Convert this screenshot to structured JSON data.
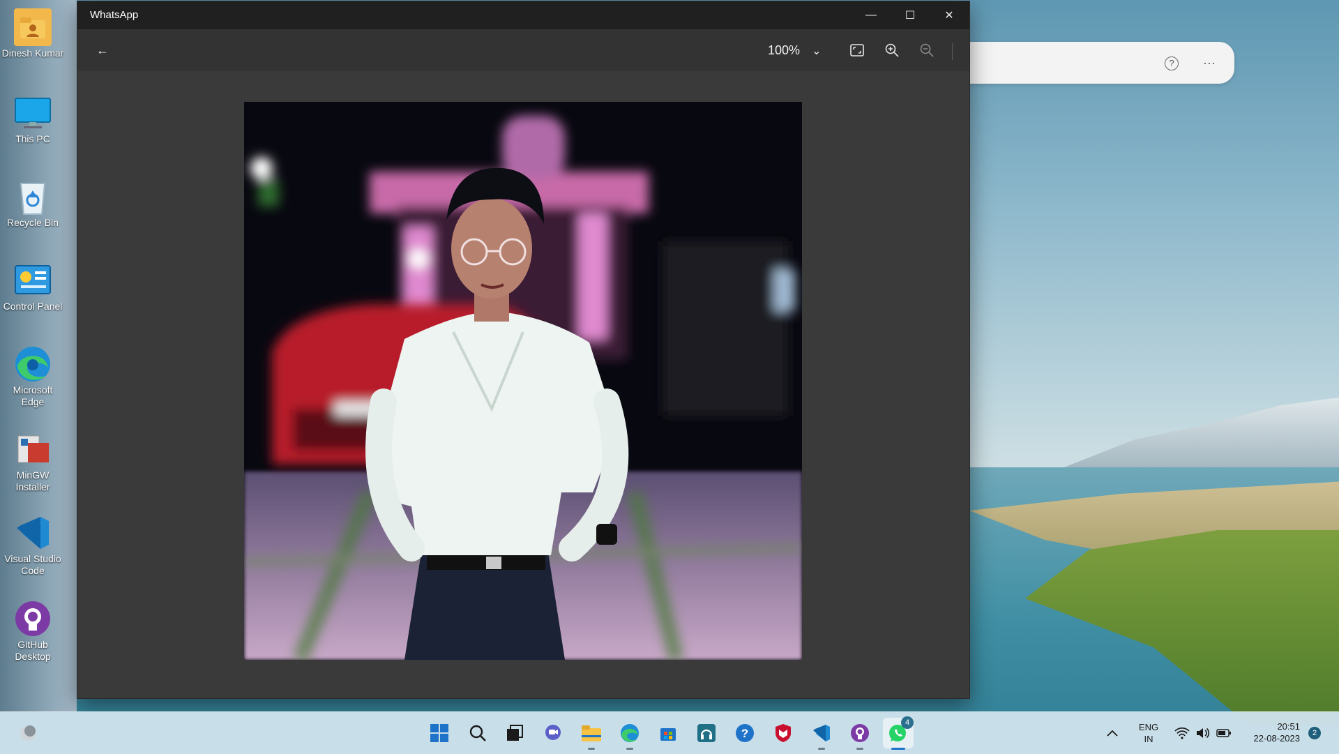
{
  "desktop": {
    "icons": [
      {
        "label": "Dinesh Kumar",
        "icon": "user-folder-icon"
      },
      {
        "label": "This PC",
        "icon": "monitor-icon"
      },
      {
        "label": "Recycle Bin",
        "icon": "recycle-bin-icon"
      },
      {
        "label": "Control Panel",
        "icon": "control-panel-icon"
      },
      {
        "label": "Microsoft Edge",
        "icon": "edge-icon"
      },
      {
        "label": "MinGW Installer",
        "icon": "installer-icon"
      },
      {
        "label": "Visual Studio Code",
        "icon": "vscode-icon"
      },
      {
        "label": "GitHub Desktop",
        "icon": "github-icon"
      }
    ]
  },
  "background_window": {
    "help_icon": "?",
    "more_icon": "···"
  },
  "window": {
    "title": "WhatsApp",
    "minimize_icon": "—",
    "maximize_icon": "☐",
    "close_icon": "✕"
  },
  "toolbar": {
    "back_icon": "←",
    "zoom_level": "100%",
    "zoom_dropdown_icon": "⌄",
    "fit_icon": "⛶",
    "zoom_in_icon": "⊕",
    "zoom_out_icon": "⊖"
  },
  "photo": {
    "description_icon": "portrait-photo"
  },
  "taskbar": {
    "language_line1": "ENG",
    "language_line2": "IN",
    "time": "20:51",
    "date": "22-08-2023",
    "notification_count": "2",
    "whatsapp_badge": "4",
    "accent": "#1e73c9"
  }
}
